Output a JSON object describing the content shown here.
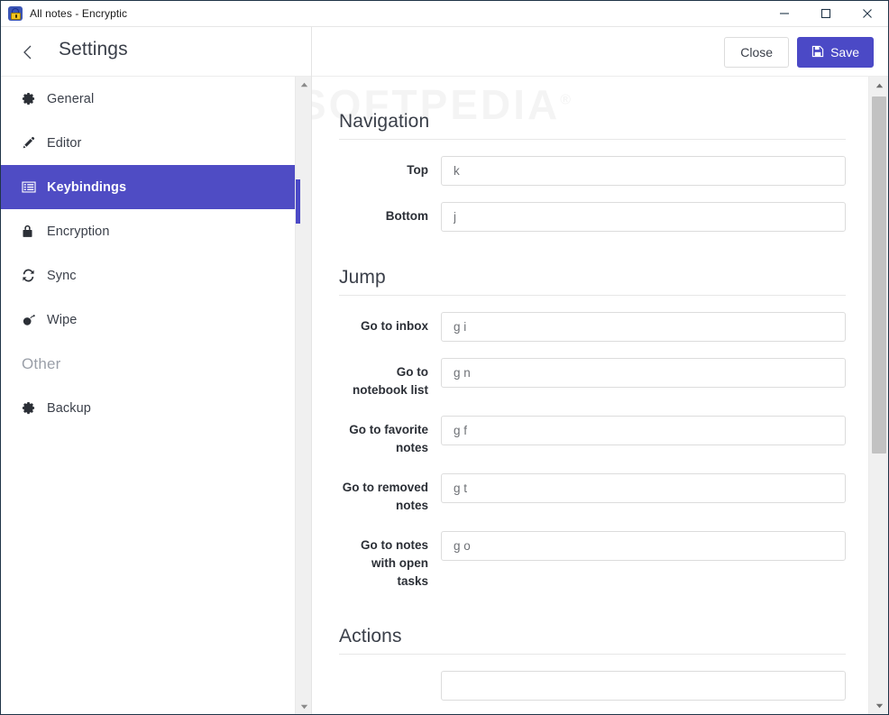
{
  "window": {
    "title": "All notes - Encryptic",
    "app_icon": "lock-icon",
    "minimize_label": "Minimize",
    "maximize_label": "Maximize",
    "close_label": "Close"
  },
  "header": {
    "back_icon": "chevron-left-icon",
    "title": "Settings",
    "close_label": "Close",
    "save_label": "Save",
    "save_icon": "floppy-disk-icon",
    "accent_color": "#4b49c6"
  },
  "sidebar": {
    "items": [
      {
        "label": "General",
        "icon": "gear-icon",
        "active": false
      },
      {
        "label": "Editor",
        "icon": "pencil-icon",
        "active": false
      },
      {
        "label": "Keybindings",
        "icon": "list-indent-icon",
        "active": true
      },
      {
        "label": "Encryption",
        "icon": "lock-icon",
        "active": false
      },
      {
        "label": "Sync",
        "icon": "sync-icon",
        "active": false
      },
      {
        "label": "Wipe",
        "icon": "bomb-icon",
        "active": false
      }
    ],
    "section_label": "Other",
    "other_items": [
      {
        "label": "Backup",
        "icon": "gear-icon",
        "active": false
      }
    ]
  },
  "watermark": {
    "text": "SOFTPEDIA",
    "mark": "®"
  },
  "content": {
    "sections": [
      {
        "title": "Navigation",
        "fields": [
          {
            "label": "Top",
            "value": "k"
          },
          {
            "label": "Bottom",
            "value": "j"
          }
        ]
      },
      {
        "title": "Jump",
        "fields": [
          {
            "label": "Go to inbox",
            "value": "g i"
          },
          {
            "label": "Go to notebook list",
            "value": "g n"
          },
          {
            "label": "Go to favorite notes",
            "value": "g f"
          },
          {
            "label": "Go to removed notes",
            "value": "g t"
          },
          {
            "label": "Go to notes with open tasks",
            "value": "g o"
          }
        ]
      },
      {
        "title": "Actions",
        "fields": [
          {
            "label": "",
            "value": ""
          }
        ]
      }
    ]
  }
}
